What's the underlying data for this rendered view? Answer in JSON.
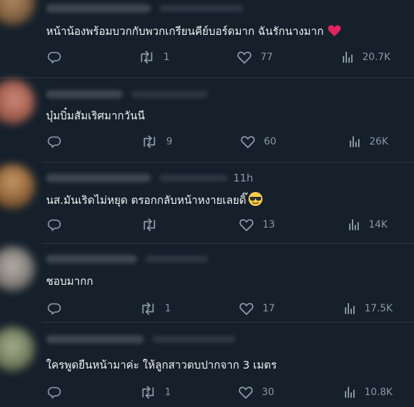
{
  "tweets": [
    {
      "time": "",
      "text": "หน้าน้องพร้อมบวกกับพวกเกรียนคีย์บอร์ดมาก ฉันรักนางมาก",
      "emoji": "heart",
      "replies": "",
      "retweets": "1",
      "likes": "77",
      "views": "20.7K",
      "avatar_color": "#8a6a4a"
    },
    {
      "time": "",
      "text": "บุ๋มบิ๋มสัมเริศมากวันนี",
      "emoji": "",
      "replies": "",
      "retweets": "9",
      "likes": "60",
      "views": "26K",
      "avatar_color": "#b06a5a"
    },
    {
      "time": "11h",
      "text": "นส.มันเริดไม่หยุด ตรอกกลับหน้าหงายเลยดิ๊",
      "emoji": "cool",
      "replies": "",
      "retweets": "",
      "likes": "13",
      "views": "14K",
      "avatar_color": "#a06f45"
    },
    {
      "time": "",
      "text": "ชอบมากก",
      "emoji": "",
      "replies": "",
      "retweets": "1",
      "likes": "17",
      "views": "17.5K",
      "avatar_color": "#8f8a86"
    },
    {
      "time": "",
      "text": "ใครพูดยืนหน้ามาค่ะ ให้ลูกสาวตบปากจาก 3 เมตร",
      "emoji": "",
      "replies": "",
      "retweets": "1",
      "likes": "30",
      "views": "10.8K",
      "avatar_color": "#7d8a6c"
    }
  ],
  "colors": {
    "background": "#15202b",
    "text": "#e7e9ea",
    "muted": "#8b98a5",
    "heart": "#e0245e"
  }
}
